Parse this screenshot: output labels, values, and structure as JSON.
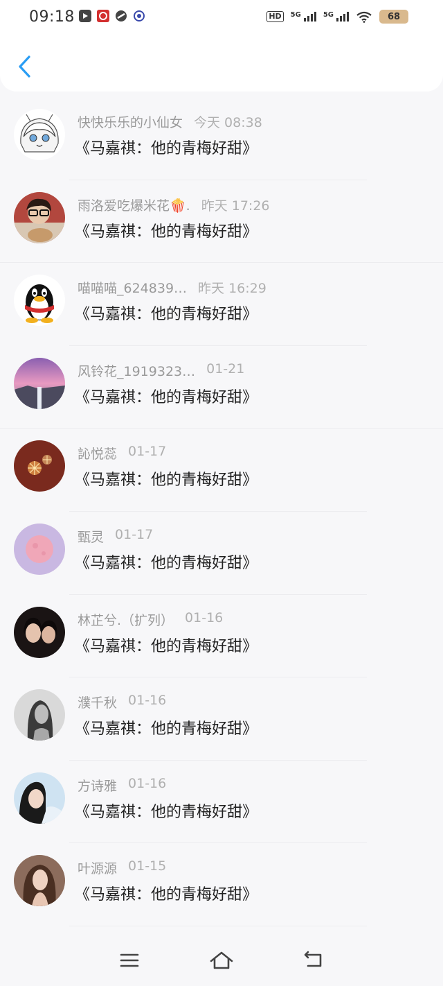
{
  "status_bar": {
    "time": "09:18",
    "apps": [
      "media-app-icon",
      "red-app-icon",
      "link-app-icon",
      "blue-app-icon"
    ],
    "hd_label": "HD",
    "sim1": "5G",
    "sim2": "5G",
    "battery": "68",
    "battery_color": "#d9b98d"
  },
  "header": {
    "back_icon": "chevron-left-icon",
    "accent": "#2a9df4"
  },
  "messages": [
    {
      "name": "快快乐乐的小仙女",
      "time": "今天 08:38",
      "text": "《马嘉祺：他的青梅好甜》",
      "avatar": "anime-girl"
    },
    {
      "name": "雨洛爱吃爆米花🍿.",
      "time": "昨天 17:26",
      "text": "《马嘉祺：他的青梅好甜》",
      "avatar": "boy-with-glasses"
    },
    {
      "name": "喵喵喵_624839…",
      "time": "昨天 16:29",
      "text": "《马嘉祺：他的青梅好甜》",
      "avatar": "qq-penguin"
    },
    {
      "name": "风铃花_1919323…",
      "time": "01-21",
      "text": "《马嘉祺：他的青梅好甜》",
      "avatar": "pink-sky-waterfall"
    },
    {
      "name": "訫悦蕊",
      "time": "01-17",
      "text": "《马嘉祺：他的青梅好甜》",
      "avatar": "sparklers"
    },
    {
      "name": "甄灵",
      "time": "01-17",
      "text": "《马嘉祺：他的青梅好甜》",
      "avatar": "pink-moon"
    },
    {
      "name": "林芷兮.（扩列）",
      "time": "01-16",
      "text": "《马嘉祺：他的青梅好甜》",
      "avatar": "two-girls"
    },
    {
      "name": "濮千秋",
      "time": "01-16",
      "text": "《马嘉祺：他的青梅好甜》",
      "avatar": "bw-portrait"
    },
    {
      "name": "方诗雅",
      "time": "01-16",
      "text": "《马嘉祺：他的青梅好甜》",
      "avatar": "girl-blue"
    },
    {
      "name": "叶源源",
      "time": "01-15",
      "text": "《马嘉祺：他的青梅好甜》",
      "avatar": "girl-brown-hair"
    }
  ],
  "navbar": {
    "menu_icon": "menu-icon",
    "home_icon": "home-icon",
    "back_icon": "back-arrow-icon"
  }
}
